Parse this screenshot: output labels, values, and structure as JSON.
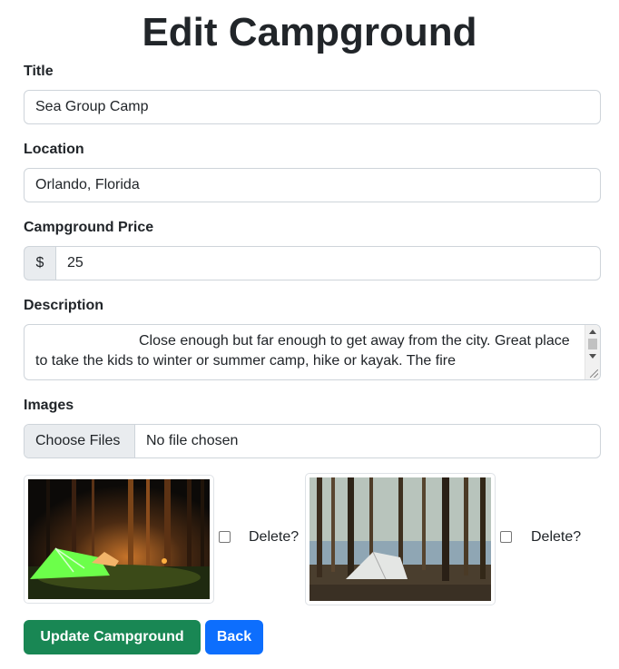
{
  "page": {
    "title": "Edit Campground"
  },
  "form": {
    "title_label": "Title",
    "title_value": "Sea Group Camp",
    "location_label": "Location",
    "location_value": "Orlando, Florida",
    "price_label": "Campground Price",
    "price_prefix": "$",
    "price_value": "25",
    "description_label": "Description",
    "description_value": "Close enough but far enough to get away from the city. Great place to take the kids to winter or summer camp, hike or kayak. The fire",
    "images_label": "Images",
    "file_button_label": "Choose Files",
    "file_status": "No file chosen"
  },
  "images": [
    {
      "delete_label": "Delete?",
      "checked": false
    },
    {
      "delete_label": "Delete?",
      "checked": false
    }
  ],
  "actions": {
    "update_label": "Update Campground",
    "back_label": "Back"
  },
  "colors": {
    "success": "#198754",
    "primary": "#0d6efd",
    "border": "#ced4da"
  }
}
